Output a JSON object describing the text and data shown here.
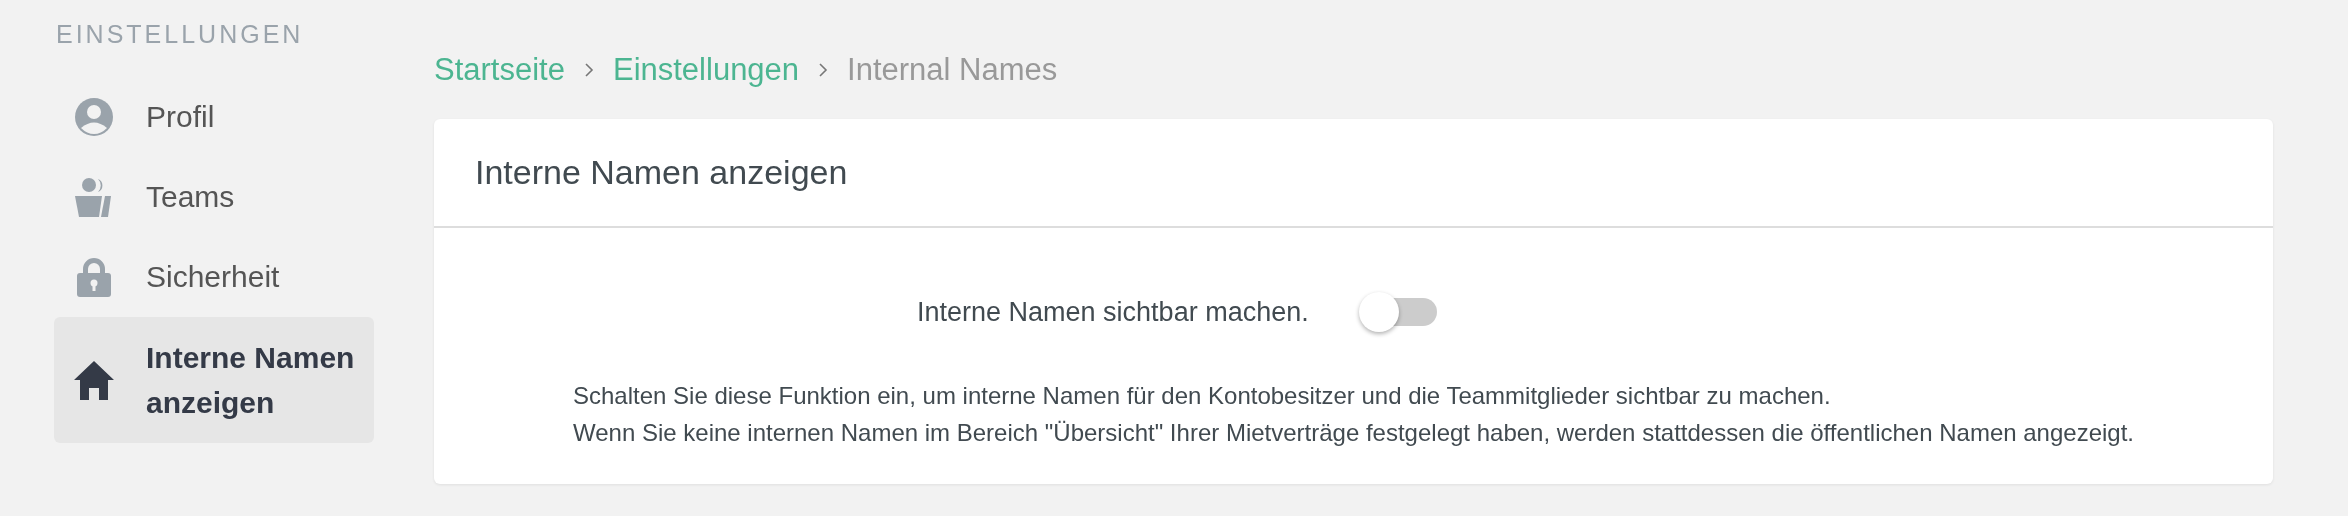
{
  "sidebar": {
    "heading": "EINSTELLUNGEN",
    "items": [
      {
        "label": "Profil",
        "selected": false
      },
      {
        "label": "Teams",
        "selected": false
      },
      {
        "label": "Sicherheit",
        "selected": false
      },
      {
        "label": "Interne Namen anzeigen",
        "selected": true
      }
    ]
  },
  "breadcrumb": [
    {
      "label": "Startseite",
      "link": true
    },
    {
      "label": "Einstellungen",
      "link": true
    },
    {
      "label": "Internal Names",
      "link": false
    }
  ],
  "card": {
    "title": "Interne Namen anzeigen",
    "toggle": {
      "label": "Interne Namen sichtbar machen.",
      "on": false
    },
    "description": [
      "Schalten Sie diese Funktion ein, um interne Namen für den Kontobesitzer und die Teammitglieder sichtbar zu machen.",
      "Wenn Sie keine internen Namen im Bereich \"Übersicht\" Ihrer Mietverträge festgelegt haben, werden stattdessen die öffentlichen Namen angezeigt."
    ]
  }
}
